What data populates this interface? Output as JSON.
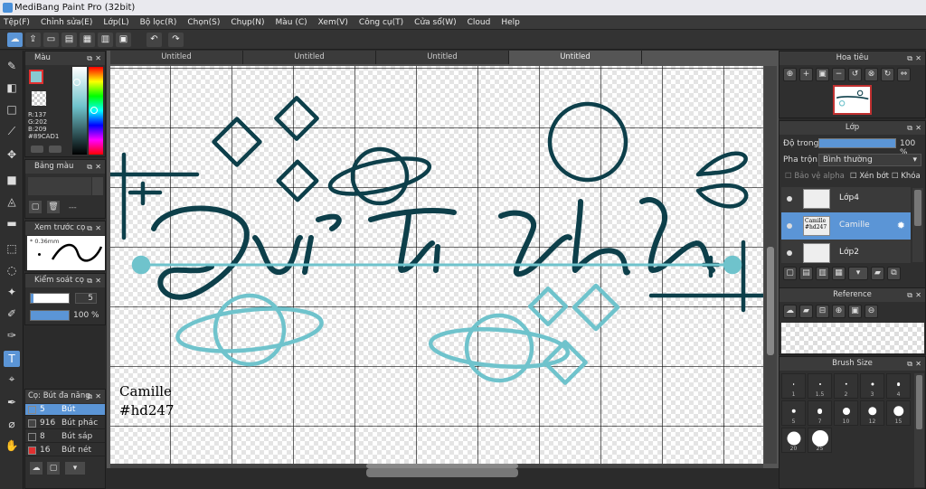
{
  "window": {
    "title": "MediBang Paint Pro (32bit)"
  },
  "menu": [
    "Tệp(F)",
    "Chỉnh sửa(E)",
    "Lớp(L)",
    "Bộ lọc(R)",
    "Chọn(S)",
    "Chụp(N)",
    "Màu (C)",
    "Xem(V)",
    "Công cụ(T)",
    "Cửa sổ(W)",
    "Cloud",
    "Help"
  ],
  "tabs": [
    "Untitled",
    "Untitled",
    "Untitled",
    "Untitled"
  ],
  "color_panel": {
    "title": "Màu",
    "r": "R:137",
    "g": "G:202",
    "b": "B:209",
    "hex": "#89CAD1",
    "color": "#89CAD1"
  },
  "palette_panel": {
    "title": "Bảng màu",
    "dash": "---"
  },
  "brush_preview": {
    "title": "Xem trước cọ",
    "size": "0.36mm"
  },
  "brush_control": {
    "title": "Kiểm soát cọ",
    "size_value": "5",
    "opacity_value": "100 %"
  },
  "brush_list": {
    "title": "Cọ: Bút đa năng",
    "items": [
      {
        "size": "5",
        "name": "Bút",
        "color": "#5b95d6"
      },
      {
        "size": "916",
        "name": "Bút phác",
        "color": "#444"
      },
      {
        "size": "8",
        "name": "Bút sáp",
        "color": "#333"
      },
      {
        "size": "16",
        "name": "Bút nét",
        "color": "#e03030"
      }
    ]
  },
  "canvas": {
    "title": "Bầu Trời Xanh",
    "signature_line1": "Camille",
    "signature_line2": "#hd247",
    "ink_dark": "#0d3f4a",
    "ink_light": "#6fc3cc"
  },
  "navigator": {
    "title": "Hoa tiêu"
  },
  "layer_panel": {
    "title": "Lớp",
    "opacity_label": "Độ trong",
    "opacity_value": "100 %",
    "blend_label": "Pha trộn",
    "blend_value": "Bình thường",
    "protect_alpha": "Bảo vệ alpha",
    "clip": "Xén bớt",
    "lock": "Khóa",
    "layers": [
      {
        "name": "Lớp4"
      },
      {
        "name": "Camille",
        "thumb": "Camille #hd247"
      },
      {
        "name": "Lớp2"
      }
    ]
  },
  "reference_panel": {
    "title": "Reference"
  },
  "brush_size_panel": {
    "title": "Brush Size",
    "sizes": [
      "1",
      "1.5",
      "2",
      "3",
      "4",
      "5",
      "7",
      "10",
      "12",
      "15",
      "20",
      "25"
    ]
  }
}
